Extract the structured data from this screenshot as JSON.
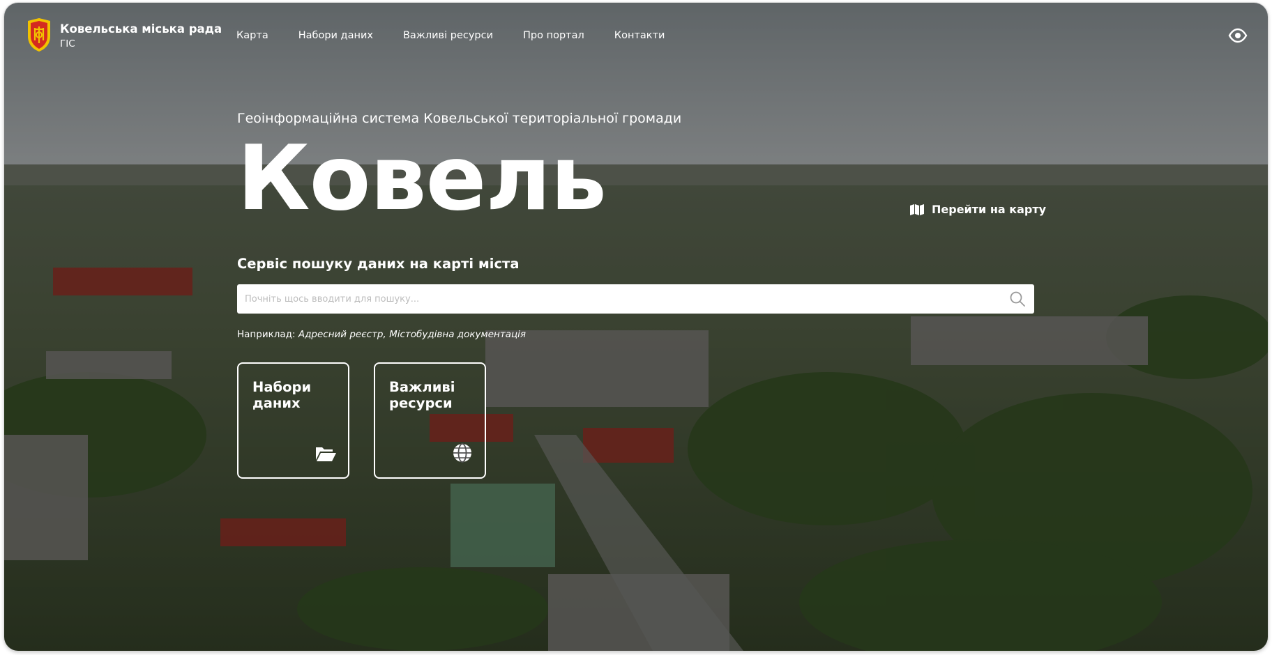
{
  "header": {
    "brand_name": "Ковельська міська рада",
    "brand_sub": "ГІС",
    "nav": [
      "Карта",
      "Набори даних",
      "Важливі ресурси",
      "Про портал",
      "Контакти"
    ]
  },
  "hero": {
    "subtitle": "Геоінформаційна система Ковельської територіальної громади",
    "title": "Ковель",
    "goto_map": "Перейти на карту",
    "service_title": "Сервіс пошуку даних на карті міста",
    "search_placeholder": "Почніть щось вводити для пошуку...",
    "example_label": "Наприклад:",
    "example_links": "Адресний реєстр, Містобудівна документація",
    "cards": [
      {
        "label": "Набори даних",
        "icon": "folder-open-icon"
      },
      {
        "label": "Важливі ресурси",
        "icon": "globe-icon"
      }
    ]
  },
  "colors": {
    "text": "#ffffff",
    "overlay": "rgba(0,0,0,0.38)",
    "search_bg": "#ffffff",
    "placeholder": "#bdbdbd",
    "logo_red": "#d42a20",
    "logo_gold": "#f2c200"
  }
}
